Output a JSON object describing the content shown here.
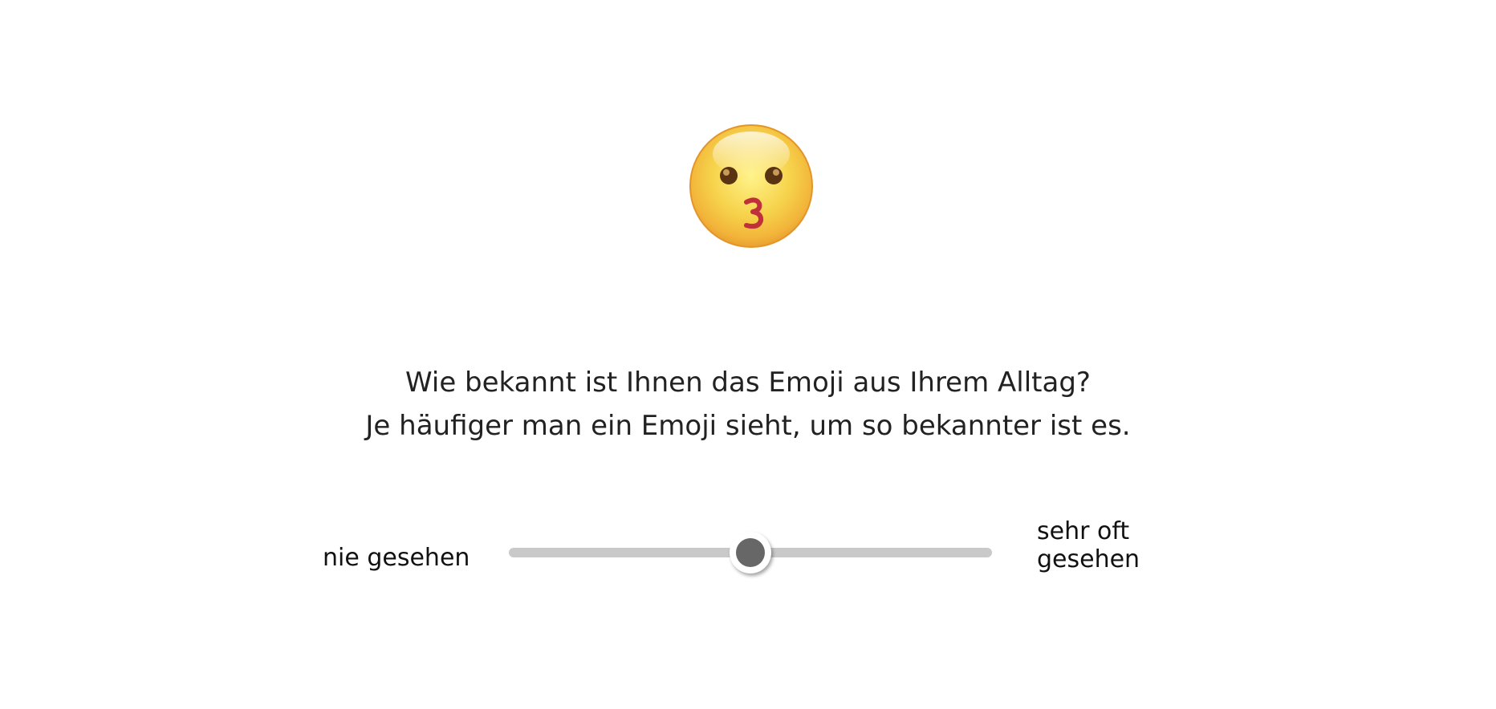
{
  "emoji": {
    "icon": "kissing-face-icon"
  },
  "question": {
    "line1": "Wie bekannt ist Ihnen das Emoji aus Ihrem Alltag?",
    "line2": "Je häufiger man ein Emoji sieht, um so bekannter ist es."
  },
  "slider": {
    "min_label": "nie gesehen",
    "max_label": "sehr oft gesehen",
    "value_fraction": 0.5,
    "track_color": "#c9c9c9",
    "thumb_color": "#676767"
  }
}
